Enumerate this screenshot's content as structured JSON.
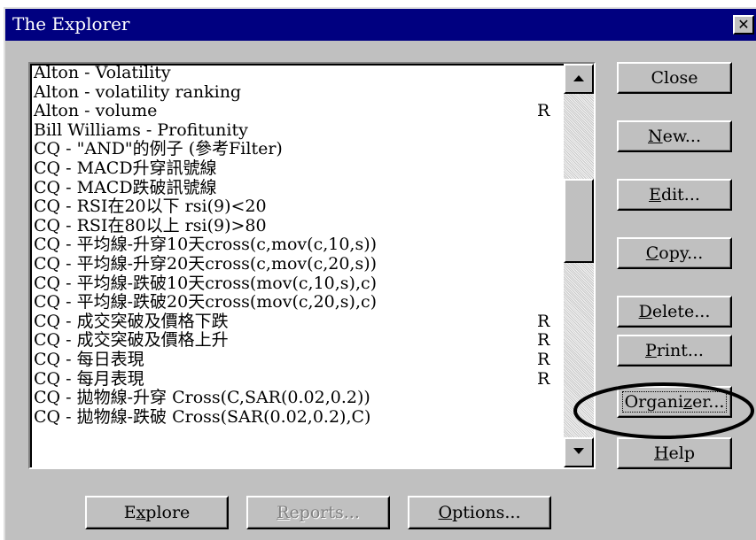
{
  "window": {
    "title": "The Explorer",
    "close_glyph": "✕"
  },
  "list": {
    "items": [
      {
        "label": "Alton - Volatility",
        "flag": ""
      },
      {
        "label": "Alton - volatility ranking",
        "flag": ""
      },
      {
        "label": "Alton - volume",
        "flag": "R"
      },
      {
        "label": "Bill Williams - Profitunity",
        "flag": ""
      },
      {
        "label": "CQ - \"AND\"的例子 (參考Filter)",
        "flag": ""
      },
      {
        "label": "CQ - MACD升穿訊號線",
        "flag": ""
      },
      {
        "label": "CQ - MACD跌破訊號線",
        "flag": ""
      },
      {
        "label": "CQ - RSI在20以下 rsi(9)<20",
        "flag": ""
      },
      {
        "label": "CQ - RSI在80以上 rsi(9)>80",
        "flag": ""
      },
      {
        "label": "CQ - 平均線-升穿10天cross(c,mov(c,10,s))",
        "flag": ""
      },
      {
        "label": "CQ - 平均線-升穿20天cross(c,mov(c,20,s))",
        "flag": ""
      },
      {
        "label": "CQ - 平均線-跌破10天cross(mov(c,10,s),c)",
        "flag": ""
      },
      {
        "label": "CQ - 平均線-跌破20天cross(mov(c,20,s),c)",
        "flag": ""
      },
      {
        "label": "CQ - 成交突破及價格下跌",
        "flag": "R"
      },
      {
        "label": "CQ - 成交突破及價格上升",
        "flag": "R"
      },
      {
        "label": "CQ - 每日表現",
        "flag": "R"
      },
      {
        "label": "CQ - 每月表現",
        "flag": "R"
      },
      {
        "label": "CQ - 拋物線-升穿 Cross(C,SAR(0.02,0.2))",
        "flag": ""
      },
      {
        "label": "CQ - 拋物線-跌破 Cross(SAR(0.02,0.2),C)",
        "flag": ""
      }
    ],
    "scroll_up_icon": "triangle-up",
    "scroll_down_icon": "triangle-down"
  },
  "side_buttons": {
    "close": {
      "label": "Close"
    },
    "new": {
      "mnemonic": "N",
      "rest": "ew..."
    },
    "edit": {
      "mnemonic": "E",
      "rest": "dit..."
    },
    "copy": {
      "mnemonic": "C",
      "rest": "opy..."
    },
    "delete": {
      "mnemonic": "D",
      "rest": "elete..."
    },
    "print": {
      "mnemonic": "P",
      "rest": "rint..."
    },
    "organizer": {
      "pre": "Organi",
      "mnemonic": "z",
      "rest": "er..."
    },
    "help": {
      "mnemonic": "H",
      "rest": "elp"
    }
  },
  "bottom_buttons": {
    "explore": {
      "pre": "E",
      "mnemonic": "x",
      "rest": "plore"
    },
    "reports": {
      "mnemonic": "R",
      "rest": "eports...",
      "disabled": true
    },
    "options": {
      "mnemonic": "O",
      "rest": "ptions..."
    }
  },
  "colors": {
    "titlebar": "#000080",
    "face": "#c0c0c0",
    "list_bg": "#ffffff",
    "disabled_text": "#808080"
  }
}
